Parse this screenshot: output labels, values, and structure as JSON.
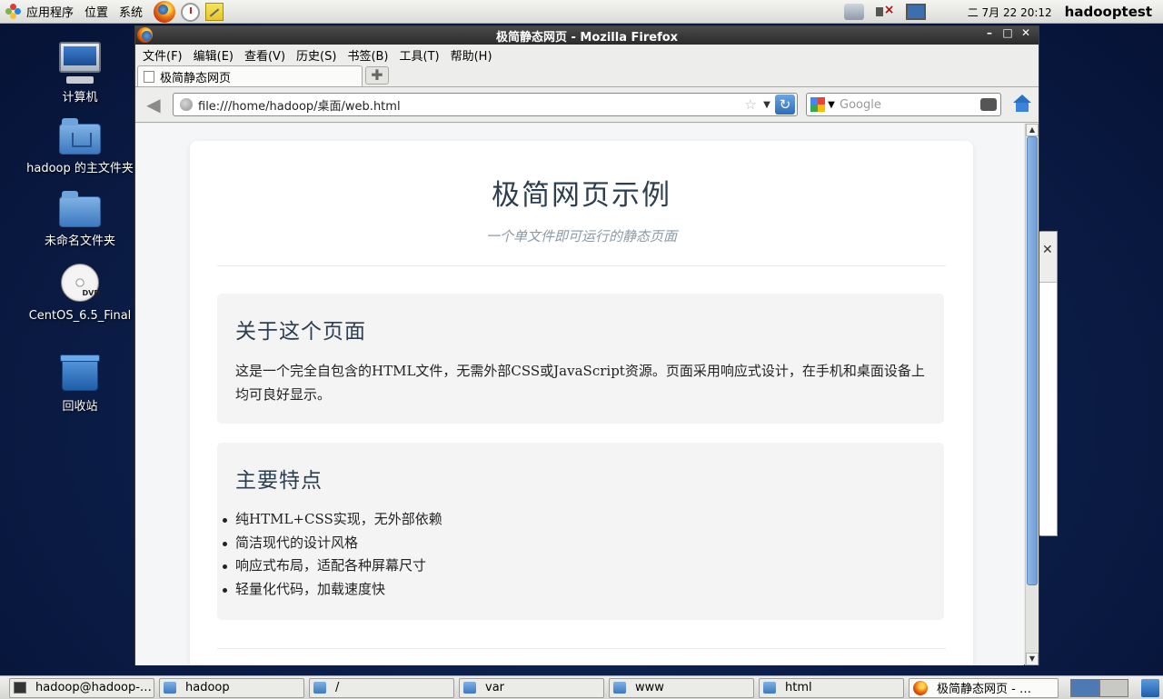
{
  "top_panel": {
    "applications": "应用程序",
    "places": "位置",
    "system": "系统",
    "clock": "二 7月 22 20:12",
    "username": "hadooptest"
  },
  "desktop": {
    "icons": [
      {
        "label": "计算机",
        "icon": "computer-icon"
      },
      {
        "label": "hadoop 的主文件夹",
        "icon": "home-folder-icon"
      },
      {
        "label": "未命名文件夹",
        "icon": "folder-icon"
      },
      {
        "label": "CentOS_6.5_Final",
        "icon": "dvd-icon"
      },
      {
        "label": "回收站",
        "icon": "trash-icon"
      }
    ]
  },
  "window": {
    "title": "极简静态网页 - Mozilla Firefox",
    "menu": [
      "文件(F)",
      "编辑(E)",
      "查看(V)",
      "历史(S)",
      "书签(B)",
      "工具(T)",
      "帮助(H)"
    ],
    "tab_title": "极简静态网页",
    "url": "file:///home/hadoop/桌面/web.html",
    "search_placeholder": "Google"
  },
  "page": {
    "title": "极简网页示例",
    "subtitle": "一个单文件即可运行的静态页面",
    "about": {
      "heading": "关于这个页面",
      "body": "这是一个完全自包含的HTML文件，无需外部CSS或JavaScript资源。页面采用响应式设计，在手机和桌面设备上均可良好显示。"
    },
    "features": {
      "heading": "主要特点",
      "items": [
        "纯HTML+CSS实现，无外部依赖",
        "简洁现代的设计风格",
        "响应式布局，适配各种屏幕尺寸",
        "轻量化代码，加载速度快"
      ]
    }
  },
  "taskbar": {
    "tasks": [
      {
        "label": "hadoop@hadoop-…",
        "icon": "terminal-icon"
      },
      {
        "label": "hadoop",
        "icon": "folder-icon"
      },
      {
        "label": "/",
        "icon": "folder-icon"
      },
      {
        "label": "var",
        "icon": "folder-icon"
      },
      {
        "label": "www",
        "icon": "folder-icon"
      },
      {
        "label": "html",
        "icon": "folder-icon"
      },
      {
        "label": "极简静态网页 - …",
        "icon": "firefox-icon"
      }
    ]
  }
}
